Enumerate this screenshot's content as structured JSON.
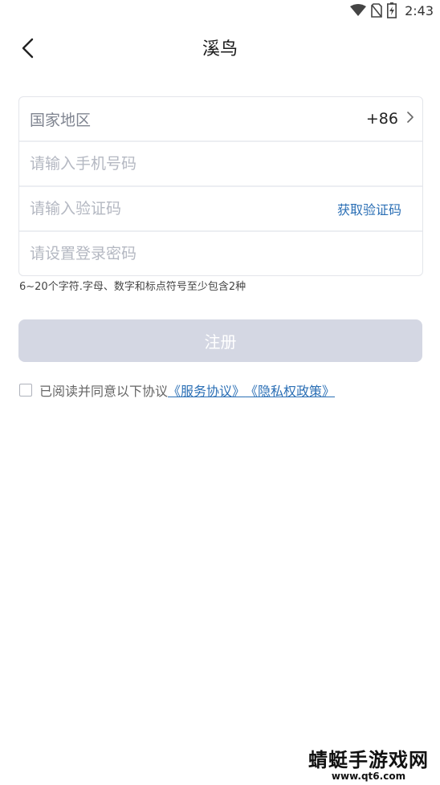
{
  "status_bar": {
    "time": "2:43",
    "icons": [
      "wifi-icon",
      "no-sim-icon",
      "battery-icon"
    ]
  },
  "header": {
    "title": "溪鸟",
    "back_icon": "back-arrow-icon"
  },
  "form": {
    "country": {
      "label": "国家地区",
      "code": "+86"
    },
    "phone": {
      "placeholder": "请输入手机号码",
      "value": ""
    },
    "verification": {
      "placeholder": "请输入验证码",
      "value": "",
      "get_code_label": "获取验证码"
    },
    "password": {
      "placeholder": "请设置登录密码",
      "value": ""
    },
    "hint": "6~20个字符.字母、数字和标点符号至少包含2种"
  },
  "register_button": {
    "label": "注册"
  },
  "agreement": {
    "checked": false,
    "text": "已阅读并同意以下协议",
    "service_link": "《服务协议》",
    "privacy_link": "《隐私权政策》"
  },
  "colors": {
    "accent": "#2b6fb5",
    "button_disabled": "#d4d7e3",
    "border": "#e3e5ea"
  },
  "watermark": {
    "title": "蜻蜓手游戏网",
    "url": "www.qt6.com"
  }
}
